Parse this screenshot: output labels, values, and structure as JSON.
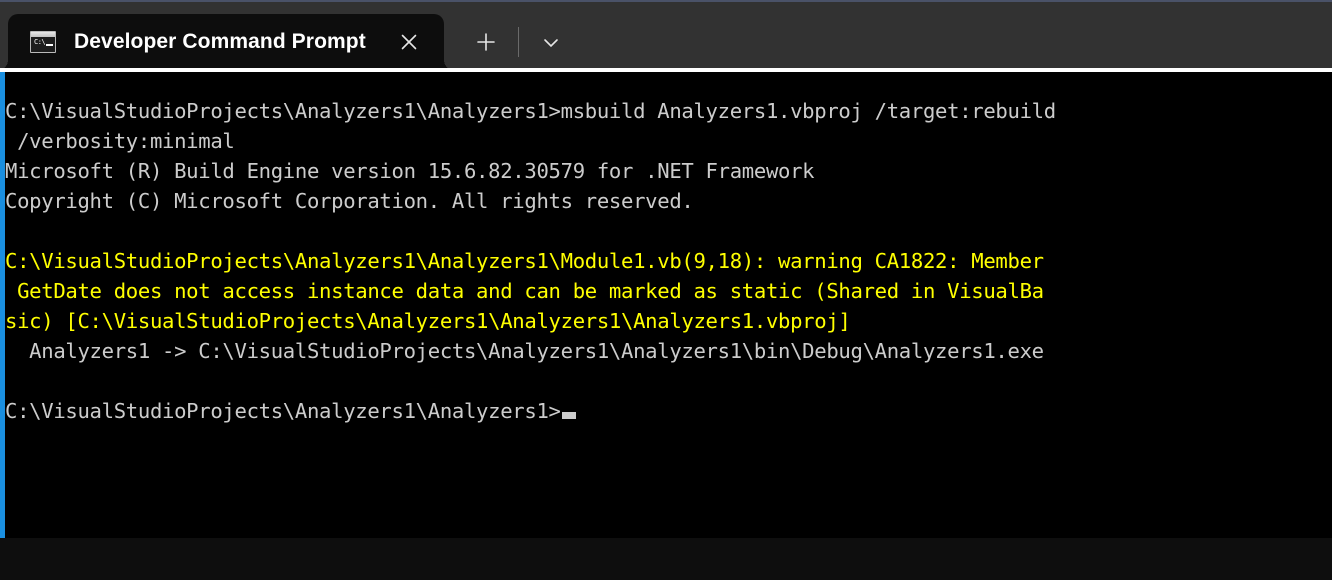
{
  "window": {
    "accent_color": "#1a8fe0",
    "titlebar_color": "#323232",
    "terminal_background": "#000000",
    "text_color": "#cccccc",
    "warning_color": "#ffff00"
  },
  "tabstrip": {
    "tabs": [
      {
        "title": "Developer Command Prompt",
        "icon": "console-icon",
        "icon_text": "C:\\",
        "close_label": "✕",
        "active": true
      }
    ],
    "new_tab_label": "+",
    "dropdown_label": "⌄"
  },
  "terminal": {
    "lines": [
      {
        "text": "C:\\VisualStudioProjects\\Analyzers1\\Analyzers1>msbuild Analyzers1.vbproj /target:rebuild",
        "color": "normal"
      },
      {
        "text": " /verbosity:minimal",
        "color": "normal"
      },
      {
        "text": "Microsoft (R) Build Engine version 15.6.82.30579 for .NET Framework",
        "color": "normal"
      },
      {
        "text": "Copyright (C) Microsoft Corporation. All rights reserved.",
        "color": "normal"
      },
      {
        "text": "",
        "color": "normal"
      },
      {
        "text": "C:\\VisualStudioProjects\\Analyzers1\\Analyzers1\\Module1.vb(9,18): warning CA1822: Member",
        "color": "warning"
      },
      {
        "text": " GetDate does not access instance data and can be marked as static (Shared in VisualBa",
        "color": "warning"
      },
      {
        "text": "sic) [C:\\VisualStudioProjects\\Analyzers1\\Analyzers1\\Analyzers1.vbproj]",
        "color": "warning"
      },
      {
        "text": "  Analyzers1 -> C:\\VisualStudioProjects\\Analyzers1\\Analyzers1\\bin\\Debug\\Analyzers1.exe",
        "color": "normal"
      },
      {
        "text": "",
        "color": "normal"
      },
      {
        "text": "C:\\VisualStudioProjects\\Analyzers1\\Analyzers1>",
        "color": "normal",
        "cursor": true
      }
    ]
  }
}
